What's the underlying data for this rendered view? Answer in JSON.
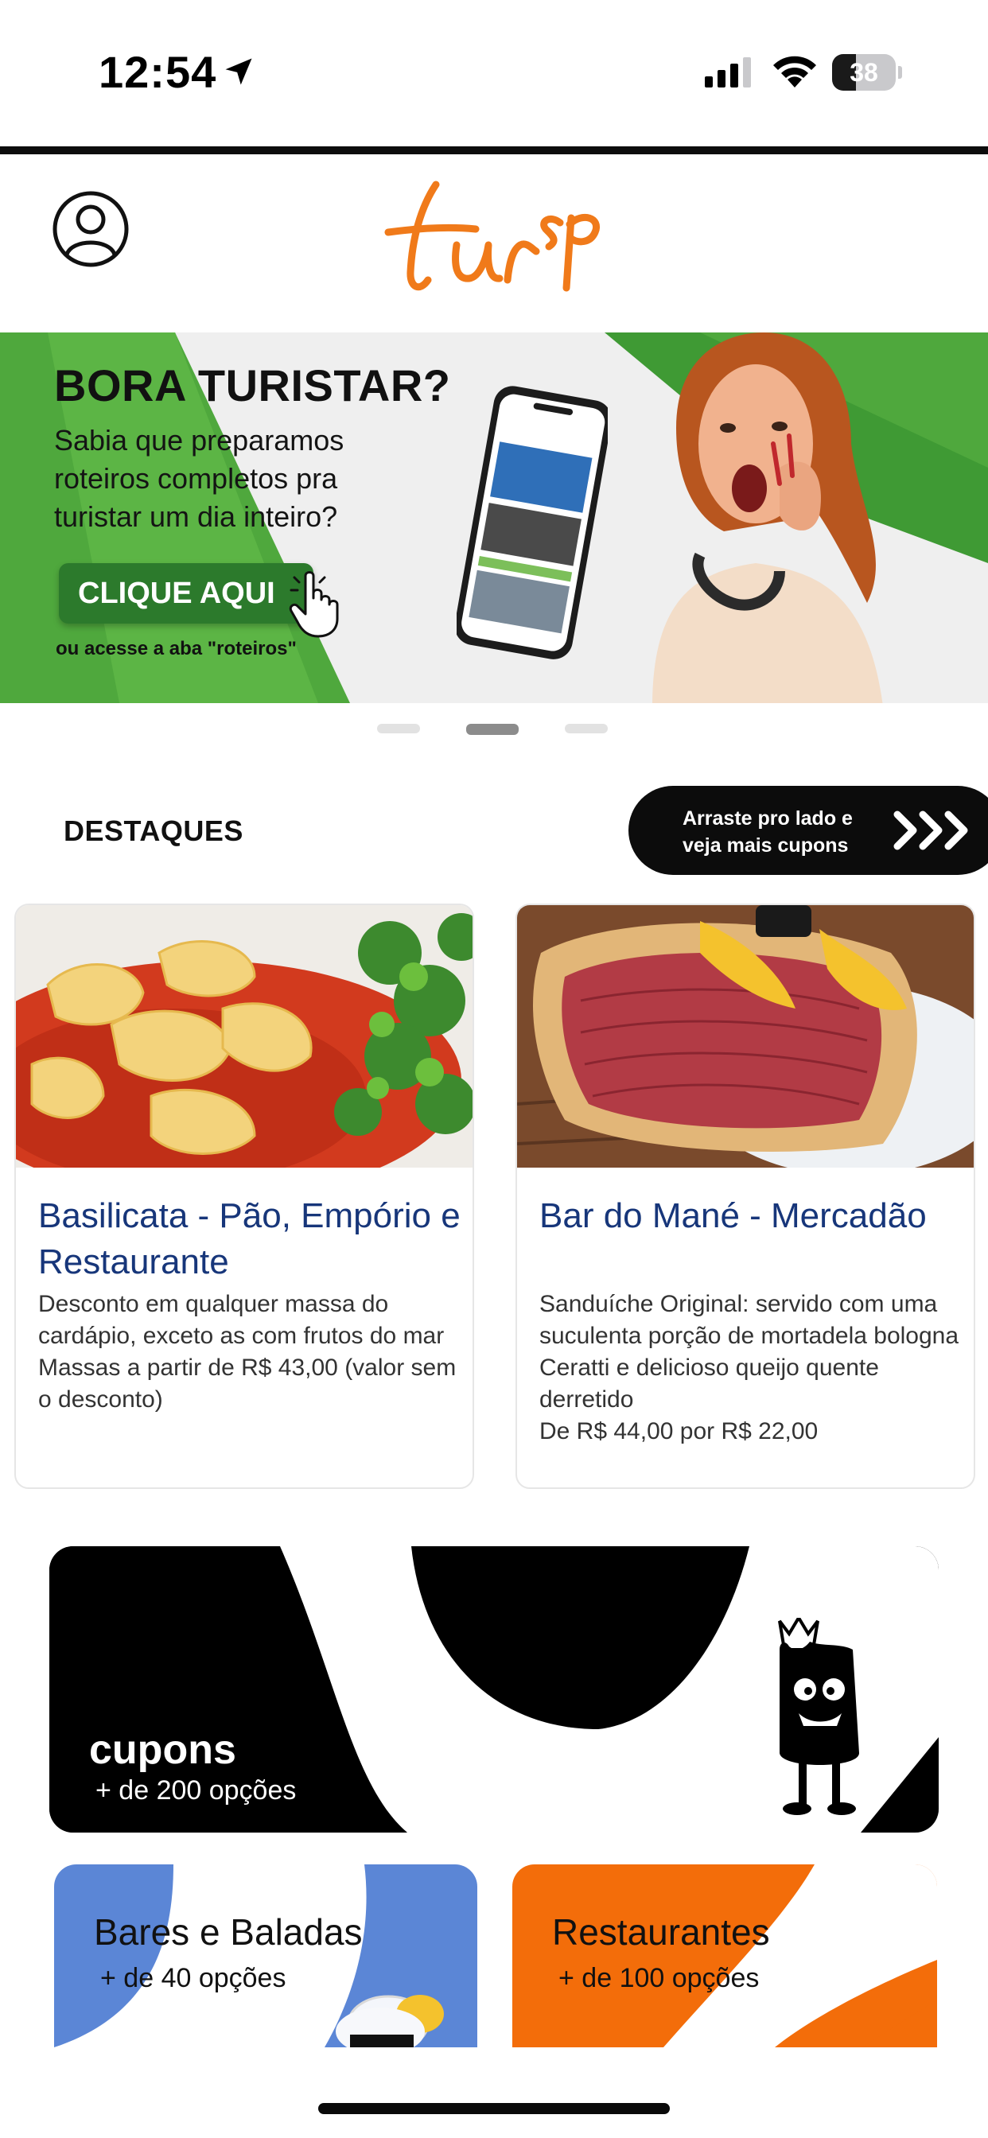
{
  "status_bar": {
    "time": "12:54",
    "battery_level": "38",
    "location_icon": "location-arrow-icon",
    "signal_icon": "cellular-signal-icon",
    "wifi_icon": "wifi-icon"
  },
  "header": {
    "profile_icon": "user-profile-icon",
    "logo_text": "turSp",
    "brand_color": "#f07a1a"
  },
  "banner": {
    "title": "BORA TURISTAR?",
    "subtitle": "Sabia que preparamos roteiros completos pra turistar um dia inteiro?",
    "cta_label": "CLIQUE AQUI",
    "note": "ou acesse a aba \"roteiros\"",
    "accent_color": "#4fa83d",
    "slides_total": 3,
    "active_slide": 2
  },
  "destaques": {
    "title": "DESTAQUES",
    "swipe_hint": "Arraste pro lado e veja mais cupons",
    "cards": [
      {
        "title": "Basilicata - Pão, Empório e Restaurante",
        "description": "Desconto em qualquer massa do cardápio, exceto as com frutos do mar\nMassas a partir de R$ 43,00 (valor sem o desconto)"
      },
      {
        "title": "Bar do Mané - Mercadão",
        "description": "Sanduíche Original: servido com uma suculenta porção de mortadela bologna Ceratti e delicioso queijo quente derretido\nDe R$ 44,00 por R$ 22,00"
      }
    ]
  },
  "cupons_banner": {
    "title": "cupons",
    "subtitle": "+ de 200 opções"
  },
  "categories": [
    {
      "title": "Bares e Baladas",
      "subtitle": "+ de 40 opções",
      "color": "#5b86d6"
    },
    {
      "title": "Restaurantes",
      "subtitle": "+ de 100 opções",
      "color": "#f36d0a"
    }
  ]
}
